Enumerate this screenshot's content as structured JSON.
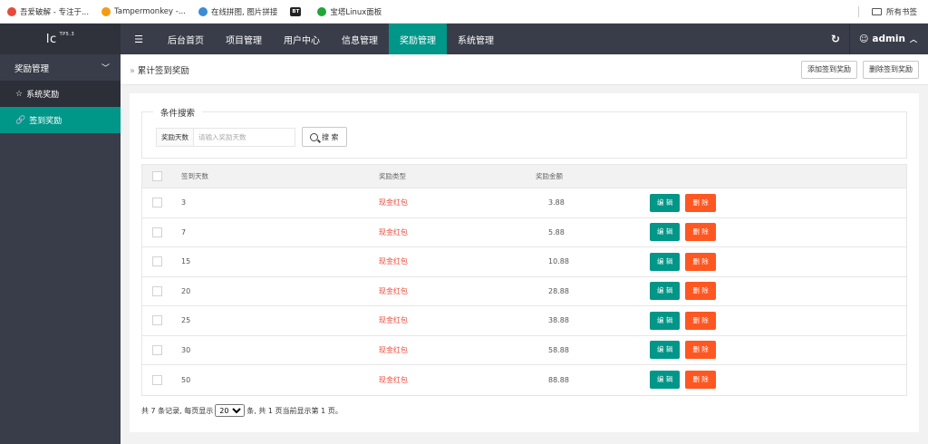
{
  "bookmarks": [
    {
      "label": "吾爱破解 - 专注于...",
      "icon": "site-favicon",
      "color": "#e64a3b"
    },
    {
      "label": "Tampermonkey -...",
      "icon": "tampermonkey-icon",
      "color": "#f39c12"
    },
    {
      "label": "在线拼图, 图片拼接",
      "icon": "puzzle-icon",
      "color": "#3b8bd6"
    },
    {
      "label": "BT",
      "icon": "bt-icon",
      "color": "#222222"
    },
    {
      "label": "宝塔Linux面板",
      "icon": "shield-icon",
      "color": "#20a53a"
    }
  ],
  "bookmarks_right": "所有书签",
  "header": {
    "logo": "lc",
    "logo_sup": "TP5.3",
    "nav": [
      "后台首页",
      "项目管理",
      "用户中心",
      "信息管理",
      "奖励管理",
      "系统管理"
    ],
    "active_nav": 4,
    "user": "admin",
    "accent": "#009688"
  },
  "sidebar": {
    "group": "奖励管理",
    "items": [
      "系统奖励",
      "签到奖励"
    ]
  },
  "breadcrumb": {
    "title": "累计签到奖励",
    "add_button": "添加签到奖励",
    "delete_button": "删除签到奖励"
  },
  "search": {
    "legend": "条件搜索",
    "label": "奖励天数",
    "placeholder": "请输入奖励天数",
    "button": "搜 索"
  },
  "table": {
    "headers": [
      "签到天数",
      "奖励类型",
      "奖励金额"
    ],
    "edit_label": "编 辑",
    "delete_label": "删 除",
    "rows": [
      {
        "days": "3",
        "type": "现金红包",
        "amount": "3.88"
      },
      {
        "days": "7",
        "type": "现金红包",
        "amount": "5.88"
      },
      {
        "days": "15",
        "type": "现金红包",
        "amount": "10.88"
      },
      {
        "days": "20",
        "type": "现金红包",
        "amount": "28.88"
      },
      {
        "days": "25",
        "type": "现金红包",
        "amount": "38.88"
      },
      {
        "days": "30",
        "type": "现金红包",
        "amount": "58.88"
      },
      {
        "days": "50",
        "type": "现金红包",
        "amount": "88.88"
      }
    ]
  },
  "pager": {
    "prefix": "共 7 条记录, 每页显示",
    "page_size": "20",
    "suffix": "条, 共 1 页当前显示第 1 页。"
  }
}
